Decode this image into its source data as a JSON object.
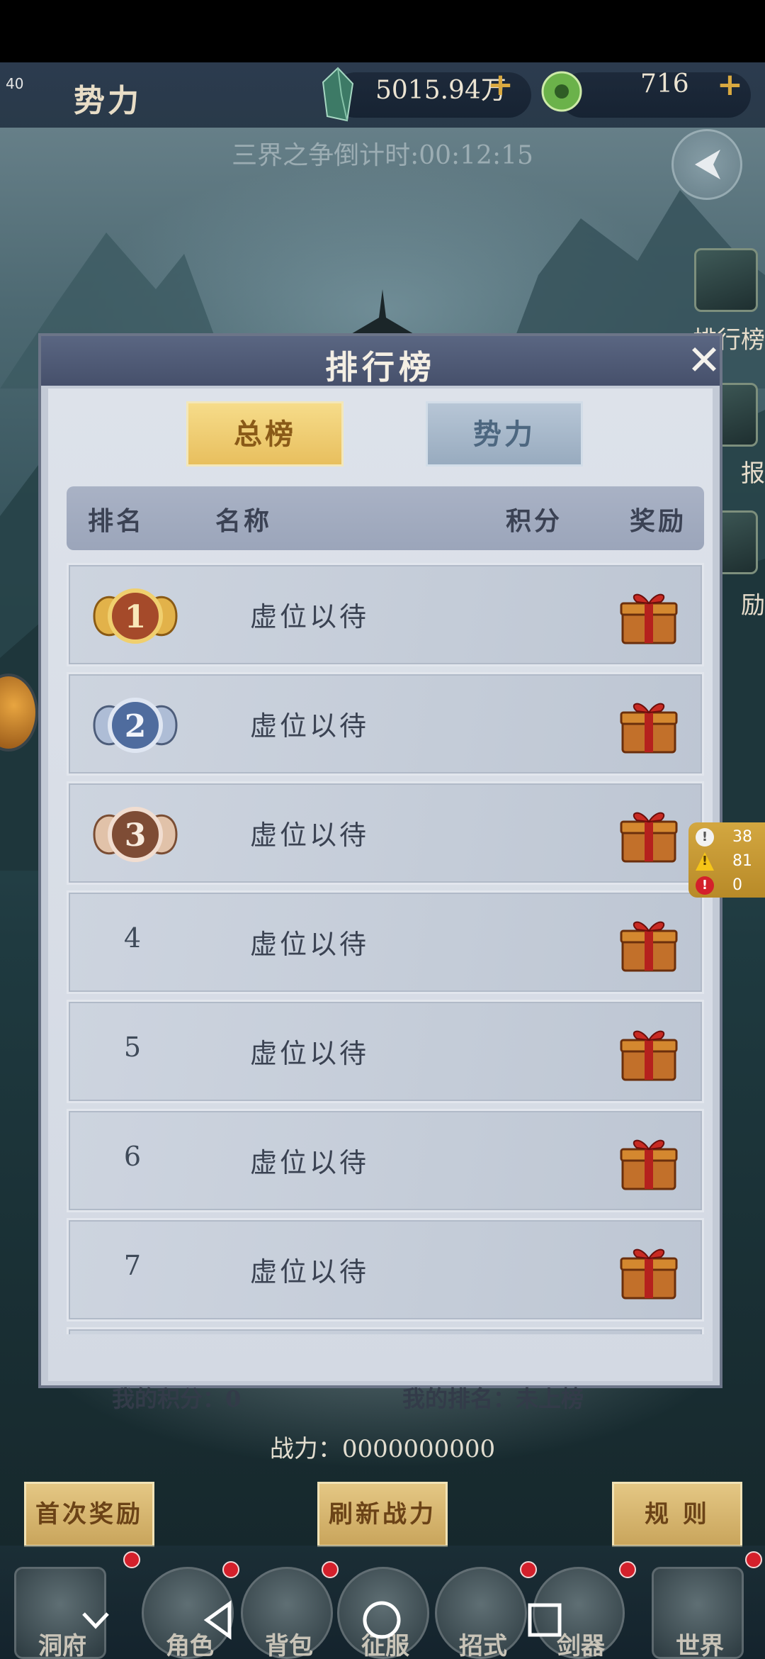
{
  "hud": {
    "fps": "40",
    "title": "势力",
    "jade_value": "5015.94万",
    "coin_value": "716"
  },
  "countdown": "三界之争倒计时:00:12:15",
  "side_menu": [
    {
      "label": "排行榜",
      "icon": "scroll-icon"
    },
    {
      "label": "报",
      "icon": "report-icon"
    },
    {
      "label": "励",
      "icon": "reward-icon"
    }
  ],
  "modal": {
    "title": "排行榜",
    "tabs": [
      {
        "label": "总榜",
        "active": true
      },
      {
        "label": "势力",
        "active": false
      }
    ],
    "columns": [
      "排名",
      "名称",
      "积分",
      "奖励"
    ],
    "rows": [
      {
        "rank": "1",
        "name": "虚位以待",
        "score": "",
        "medal": "gold"
      },
      {
        "rank": "2",
        "name": "虚位以待",
        "score": "",
        "medal": "silver"
      },
      {
        "rank": "3",
        "name": "虚位以待",
        "score": "",
        "medal": "bronze"
      },
      {
        "rank": "4",
        "name": "虚位以待",
        "score": ""
      },
      {
        "rank": "5",
        "name": "虚位以待",
        "score": ""
      },
      {
        "rank": "6",
        "name": "虚位以待",
        "score": ""
      },
      {
        "rank": "7",
        "name": "虚位以待",
        "score": ""
      }
    ],
    "my_score": "我的积分：0",
    "my_rank": "我的排名：未上榜"
  },
  "warnings": [
    {
      "icon": "info-icon",
      "count": "38",
      "color": "#f2f2f2"
    },
    {
      "icon": "warning-icon",
      "count": "81",
      "color": "#f5c518"
    },
    {
      "icon": "error-icon",
      "count": "0",
      "color": "#d4202b"
    }
  ],
  "power": "战力：0000000000",
  "bottom_buttons": {
    "first_reward": "首次奖励",
    "refresh_power": "刷新战力",
    "rules": "规 则"
  },
  "nav": [
    "洞府",
    "角色",
    "背包",
    "征服",
    "招式",
    "剑器",
    "世界"
  ],
  "colors": {
    "accent_gold": "#e8bf5e",
    "tab_blue": "#98abbf",
    "notify_red": "#d4202b"
  }
}
